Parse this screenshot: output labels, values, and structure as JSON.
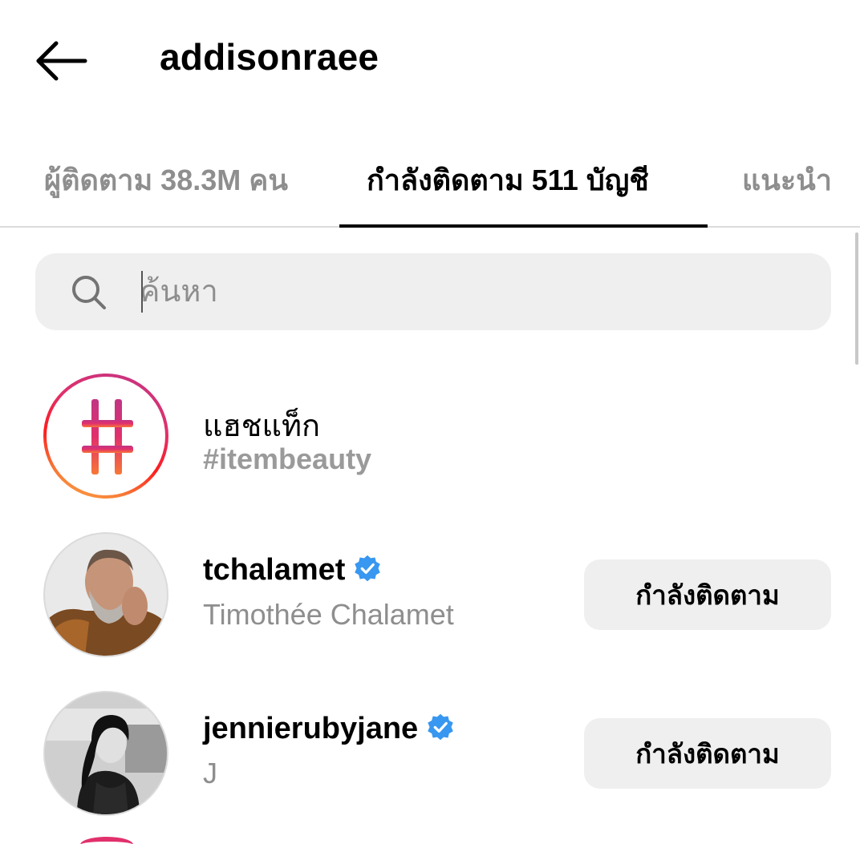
{
  "header": {
    "title": "addisonraee",
    "back_icon": "arrow-left-icon"
  },
  "tabs": [
    {
      "label": "ผู้ติดตาม 38.3M คน",
      "active": false
    },
    {
      "label": "กำลังติดตาม 511 บัญชี",
      "active": true
    },
    {
      "label": "แนะนำ",
      "active": false
    }
  ],
  "search": {
    "placeholder": "ค้นหา",
    "value": "",
    "icon": "search-icon"
  },
  "hashtag_item": {
    "title": "แฮชแท็ก",
    "subtitle": "#itembeauty",
    "icon": "hashtag-icon"
  },
  "accounts": [
    {
      "username": "tchalamet",
      "full_name": "Timothée Chalamet",
      "verified": true,
      "button_label": "กำลังติดตาม"
    },
    {
      "username": "jennierubyjane",
      "full_name": "J",
      "verified": true,
      "button_label": "กำลังติดตาม"
    }
  ],
  "colors": {
    "verified_blue": "#3897f0",
    "button_bg": "#efefef",
    "secondary_text": "#8e8e8e"
  }
}
